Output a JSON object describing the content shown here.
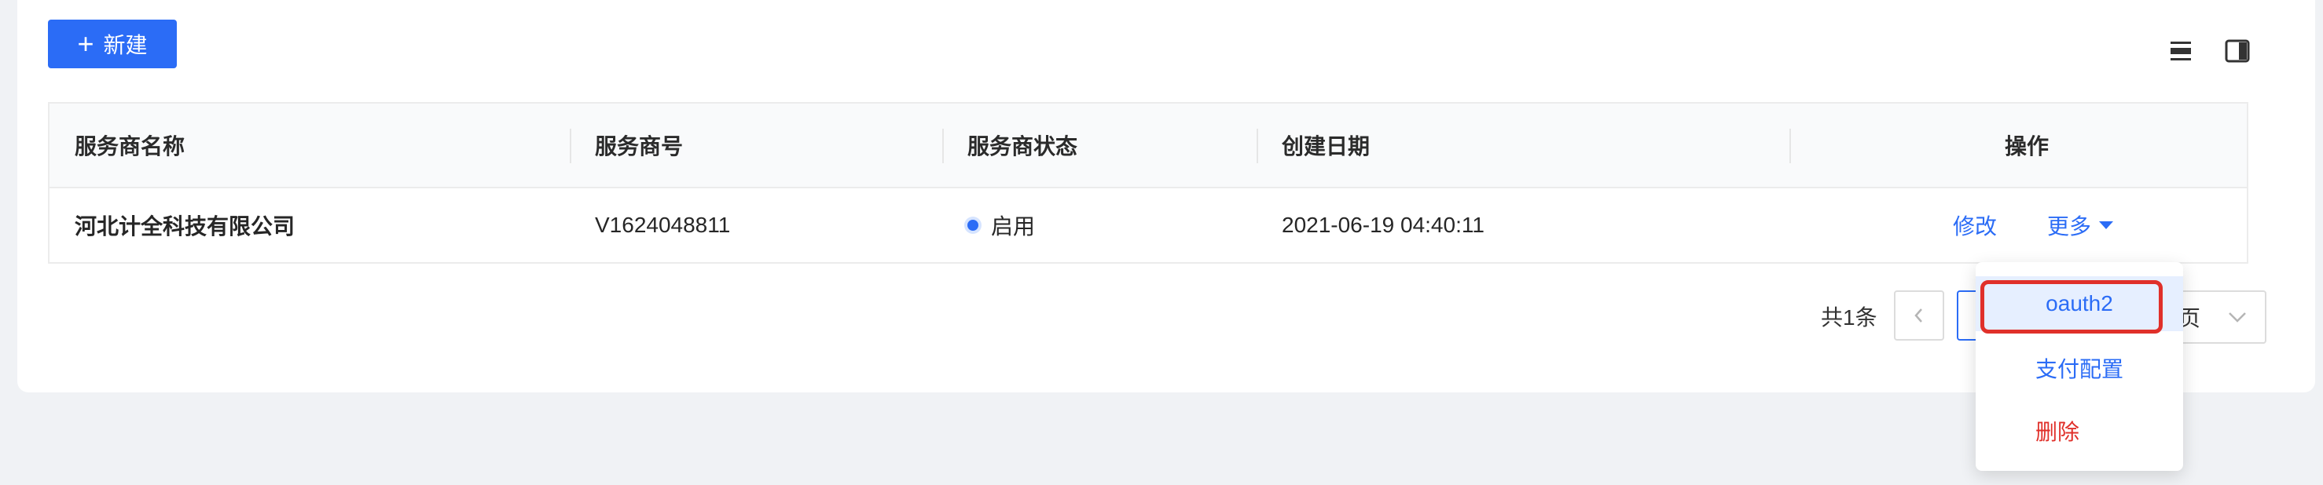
{
  "toolbar": {
    "new_button_label": "新建",
    "new_button_icon": "plus-icon",
    "density_icon": "density-icon",
    "column_settings_icon": "column-settings-icon"
  },
  "table": {
    "columns": [
      "服务商名称",
      "服务商号",
      "服务商状态",
      "创建日期",
      "操作"
    ],
    "rows": [
      {
        "name": "河北计全科技有限公司",
        "number": "V1624048811",
        "status": "启用",
        "created": "2021-06-19 04:40:11",
        "action_edit": "修改",
        "action_more": "更多"
      }
    ]
  },
  "pagination": {
    "total_text": "共1条",
    "prev_icon": "chevron-left-icon",
    "page_size_suffix": "页",
    "select_icon": "chevron-down-icon"
  },
  "more_menu": {
    "items": [
      {
        "label": "oauth2",
        "color": "#2b6cf6",
        "highlighted": true
      },
      {
        "label": "支付配置",
        "color": "#2b6cf6"
      },
      {
        "label": "删除",
        "color": "#e0302a"
      }
    ]
  },
  "colors": {
    "primary": "#2b6cf6",
    "danger": "#e0302a",
    "highlight_outline": "#e0302a"
  }
}
